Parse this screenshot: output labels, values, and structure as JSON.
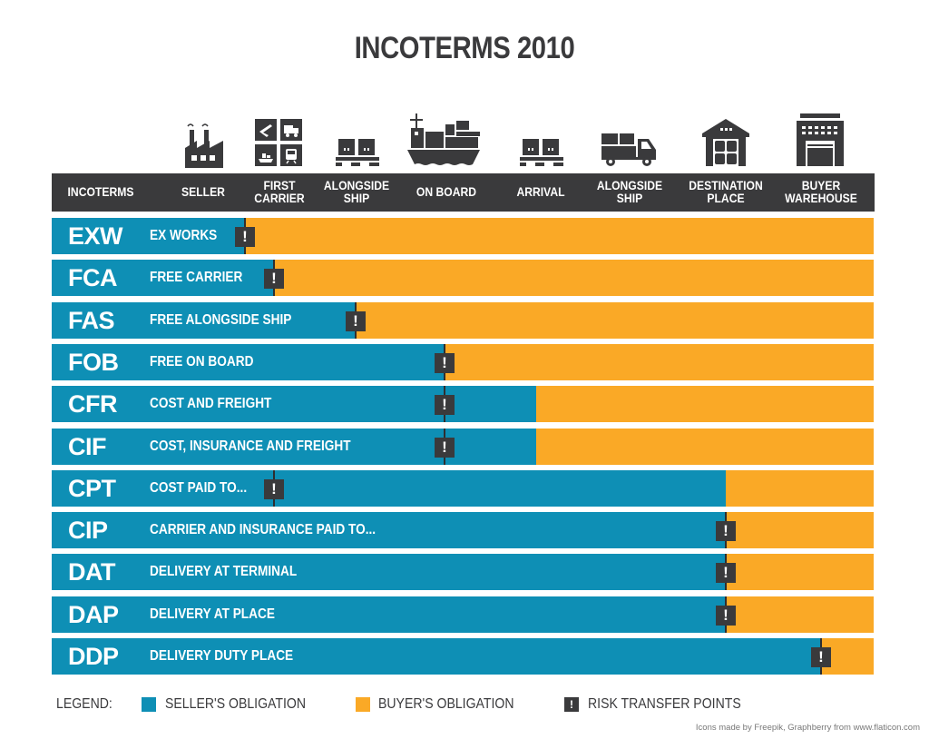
{
  "title": "INCOTERMS 2010",
  "colors": {
    "seller": "#0e8fb5",
    "buyer": "#faa926",
    "risk": "#3a3a3c",
    "header": "#3a3a3c"
  },
  "header": {
    "first_column": "INCOTERMS",
    "stages": [
      {
        "label": "SELLER",
        "icon": "factory-icon"
      },
      {
        "label": "FIRST CARRIER",
        "icon": "transport-modes-icon"
      },
      {
        "label": "ALONGSIDE SHIP",
        "icon": "pallet-boxes-icon"
      },
      {
        "label": "ON BOARD",
        "icon": "cargo-ship-icon"
      },
      {
        "label": "ARRIVAL",
        "icon": "pallet-boxes-icon"
      },
      {
        "label": "ALONGSIDE SHIP",
        "icon": "delivery-truck-icon"
      },
      {
        "label": "DESTINATION PLACE",
        "icon": "warehouse-icon"
      },
      {
        "label": "BUYER WAREHOUSE",
        "icon": "building-icon"
      }
    ]
  },
  "chart_data": {
    "type": "bar",
    "subtype": "stacked-horizontal-100",
    "title": "INCOTERMS 2010",
    "xlabel": "",
    "ylabel": "INCOTERMS",
    "x_axis_categories": [
      "SELLER",
      "FIRST CARRIER",
      "ALONGSIDE SHIP",
      "ON BOARD",
      "ARRIVAL",
      "ALONGSIDE SHIP",
      "DESTINATION PLACE",
      "BUYER WAREHOUSE"
    ],
    "xlim": [
      0,
      1
    ],
    "value_unit": "fraction of the full delivery chain",
    "categories": [
      "EXW",
      "FCA",
      "FAS",
      "FOB",
      "CFR",
      "CIF",
      "CPT",
      "CIP",
      "DAT",
      "DAP",
      "DDP"
    ],
    "names": [
      "EX WORKS",
      "FREE CARRIER",
      "FREE ALONGSIDE SHIP",
      "FREE ON BOARD",
      "COST AND FREIGHT",
      "COST, INSURANCE AND FREIGHT",
      "COST PAID TO...",
      "CARRIER AND INSURANCE PAID TO...",
      "DELIVERY AT TERMINAL",
      "DELIVERY AT PLACE",
      "DELIVERY DUTY PLACE"
    ],
    "series": [
      {
        "name": "SELLER'S OBLIGATION",
        "values": [
          0.235,
          0.27,
          0.37,
          0.478,
          0.589,
          0.589,
          0.82,
          0.82,
          0.82,
          0.82,
          0.936
        ]
      },
      {
        "name": "BUYER'S OBLIGATION",
        "values": [
          0.765,
          0.73,
          0.63,
          0.522,
          0.411,
          0.411,
          0.18,
          0.18,
          0.18,
          0.18,
          0.064
        ]
      }
    ],
    "risk_transfer_points": [
      0.235,
      0.27,
      0.37,
      0.478,
      0.478,
      0.478,
      0.27,
      0.82,
      0.82,
      0.82,
      0.936
    ],
    "legend": [
      "SELLER'S OBLIGATION",
      "BUYER'S OBLIGATION",
      "RISK TRANSFER POINTS"
    ],
    "legend_position": "bottom-left",
    "grid": false
  },
  "risk_marker_glyph": "!",
  "legend": {
    "label": "LEGEND:",
    "seller": "SELLER'S OBLIGATION",
    "buyer": "BUYER'S OBLIGATION",
    "risk": "RISK TRANSFER POINTS",
    "risk_glyph": "!"
  },
  "credit": "Icons made by Freepik, Graphberry from www.flaticon.com"
}
